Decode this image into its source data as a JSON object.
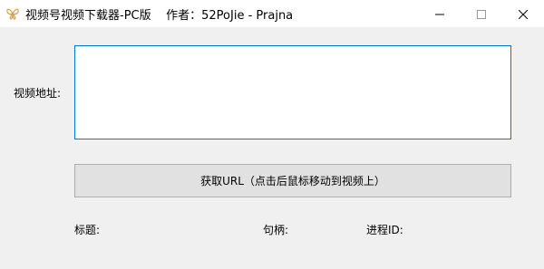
{
  "window": {
    "title": "视频号视频下载器-PC版    作者：52PoJie - Prajna",
    "icon": "app-butterfly-icon",
    "controls": {
      "minimize_icon": "minimize-icon",
      "maximize_icon": "maximize-icon",
      "close_icon": "close-icon"
    }
  },
  "form": {
    "url_label": "视频地址:",
    "url_value": "",
    "get_url_button": "获取URL（点击后鼠标移动到视频上）"
  },
  "info": {
    "title_label": "标题:",
    "handle_label": "句柄:",
    "pid_label": "进程ID:"
  },
  "colors": {
    "window_bg": "#f0f0f0",
    "titlebar_bg": "#ffffff",
    "textarea_border": "#0078d7",
    "button_bg": "#e1e1e1",
    "button_border": "#adadad"
  }
}
